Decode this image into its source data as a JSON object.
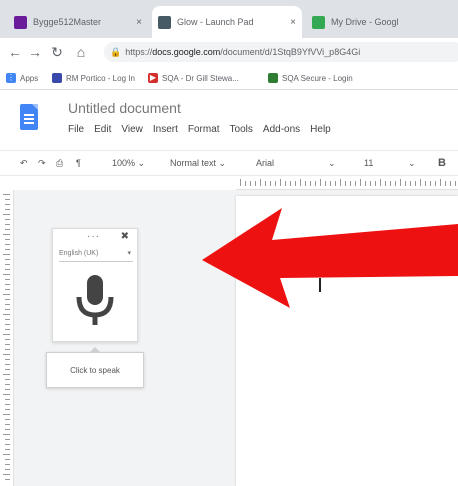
{
  "tabs": [
    {
      "label": "Bygge512Master",
      "favicon_color": "#6a1b9a"
    },
    {
      "label": "Glow - Launch Pad",
      "favicon_color": "#455a64"
    },
    {
      "label": "My Drive - Googl",
      "favicon_color": "#34a853"
    }
  ],
  "tab_close_glyph": "×",
  "address": {
    "prefix": "https://",
    "domain": "docs.google.com",
    "path": "/document/d/1StqB9YfVVi_p8G4Gi"
  },
  "bookmarks": [
    {
      "label": "Apps",
      "icon_color": "#4285f4",
      "icon": "apps-grid-icon"
    },
    {
      "label": "RM Portico - Log In",
      "icon_color": "#3949ab",
      "icon": "rm-icon"
    },
    {
      "label": "SQA - Dr Gill Stewa...",
      "icon_color": "#d32f2f",
      "icon": "youtube-icon"
    },
    {
      "label": "SQA Secure - Login",
      "icon_color": "#2e7d32",
      "icon": "sqa-icon"
    }
  ],
  "doc": {
    "title": "Untitled document",
    "menu": [
      "File",
      "Edit",
      "View",
      "Insert",
      "Format",
      "Tools",
      "Add-ons",
      "Help"
    ]
  },
  "toolbar": {
    "zoom": "100%",
    "style": "Normal text",
    "font": "Arial",
    "size": "11",
    "bold": "B"
  },
  "voice": {
    "dots": "···",
    "close": "✖",
    "language": "English (UK)",
    "tooltip": "Click to speak"
  },
  "colors": {
    "arrow": "#ee1111",
    "mic": "#444444"
  }
}
